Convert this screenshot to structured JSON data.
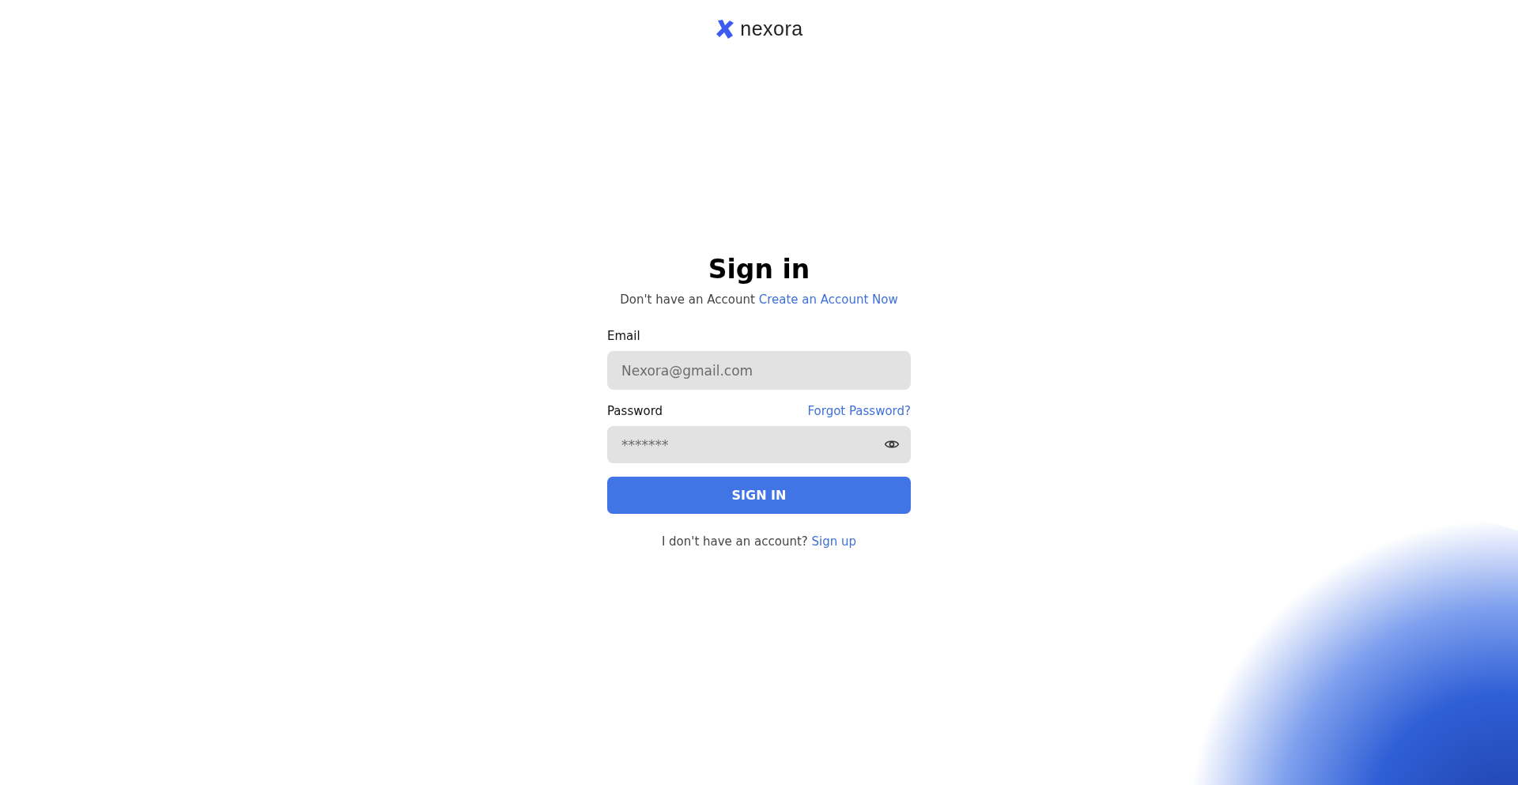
{
  "logo": {
    "text": "nexora"
  },
  "title": "Sign in",
  "subtitle": {
    "text": "Don't have an Account",
    "link": "Create an Account Now"
  },
  "email": {
    "label": "Email",
    "placeholder": "Nexora@gmail.com"
  },
  "password": {
    "label": "Password",
    "forgot_link": "Forgot Password?",
    "placeholder": "*******"
  },
  "submit_button": "SIGN IN",
  "footer": {
    "text": "I don't have an account?",
    "link": "Sign up"
  }
}
